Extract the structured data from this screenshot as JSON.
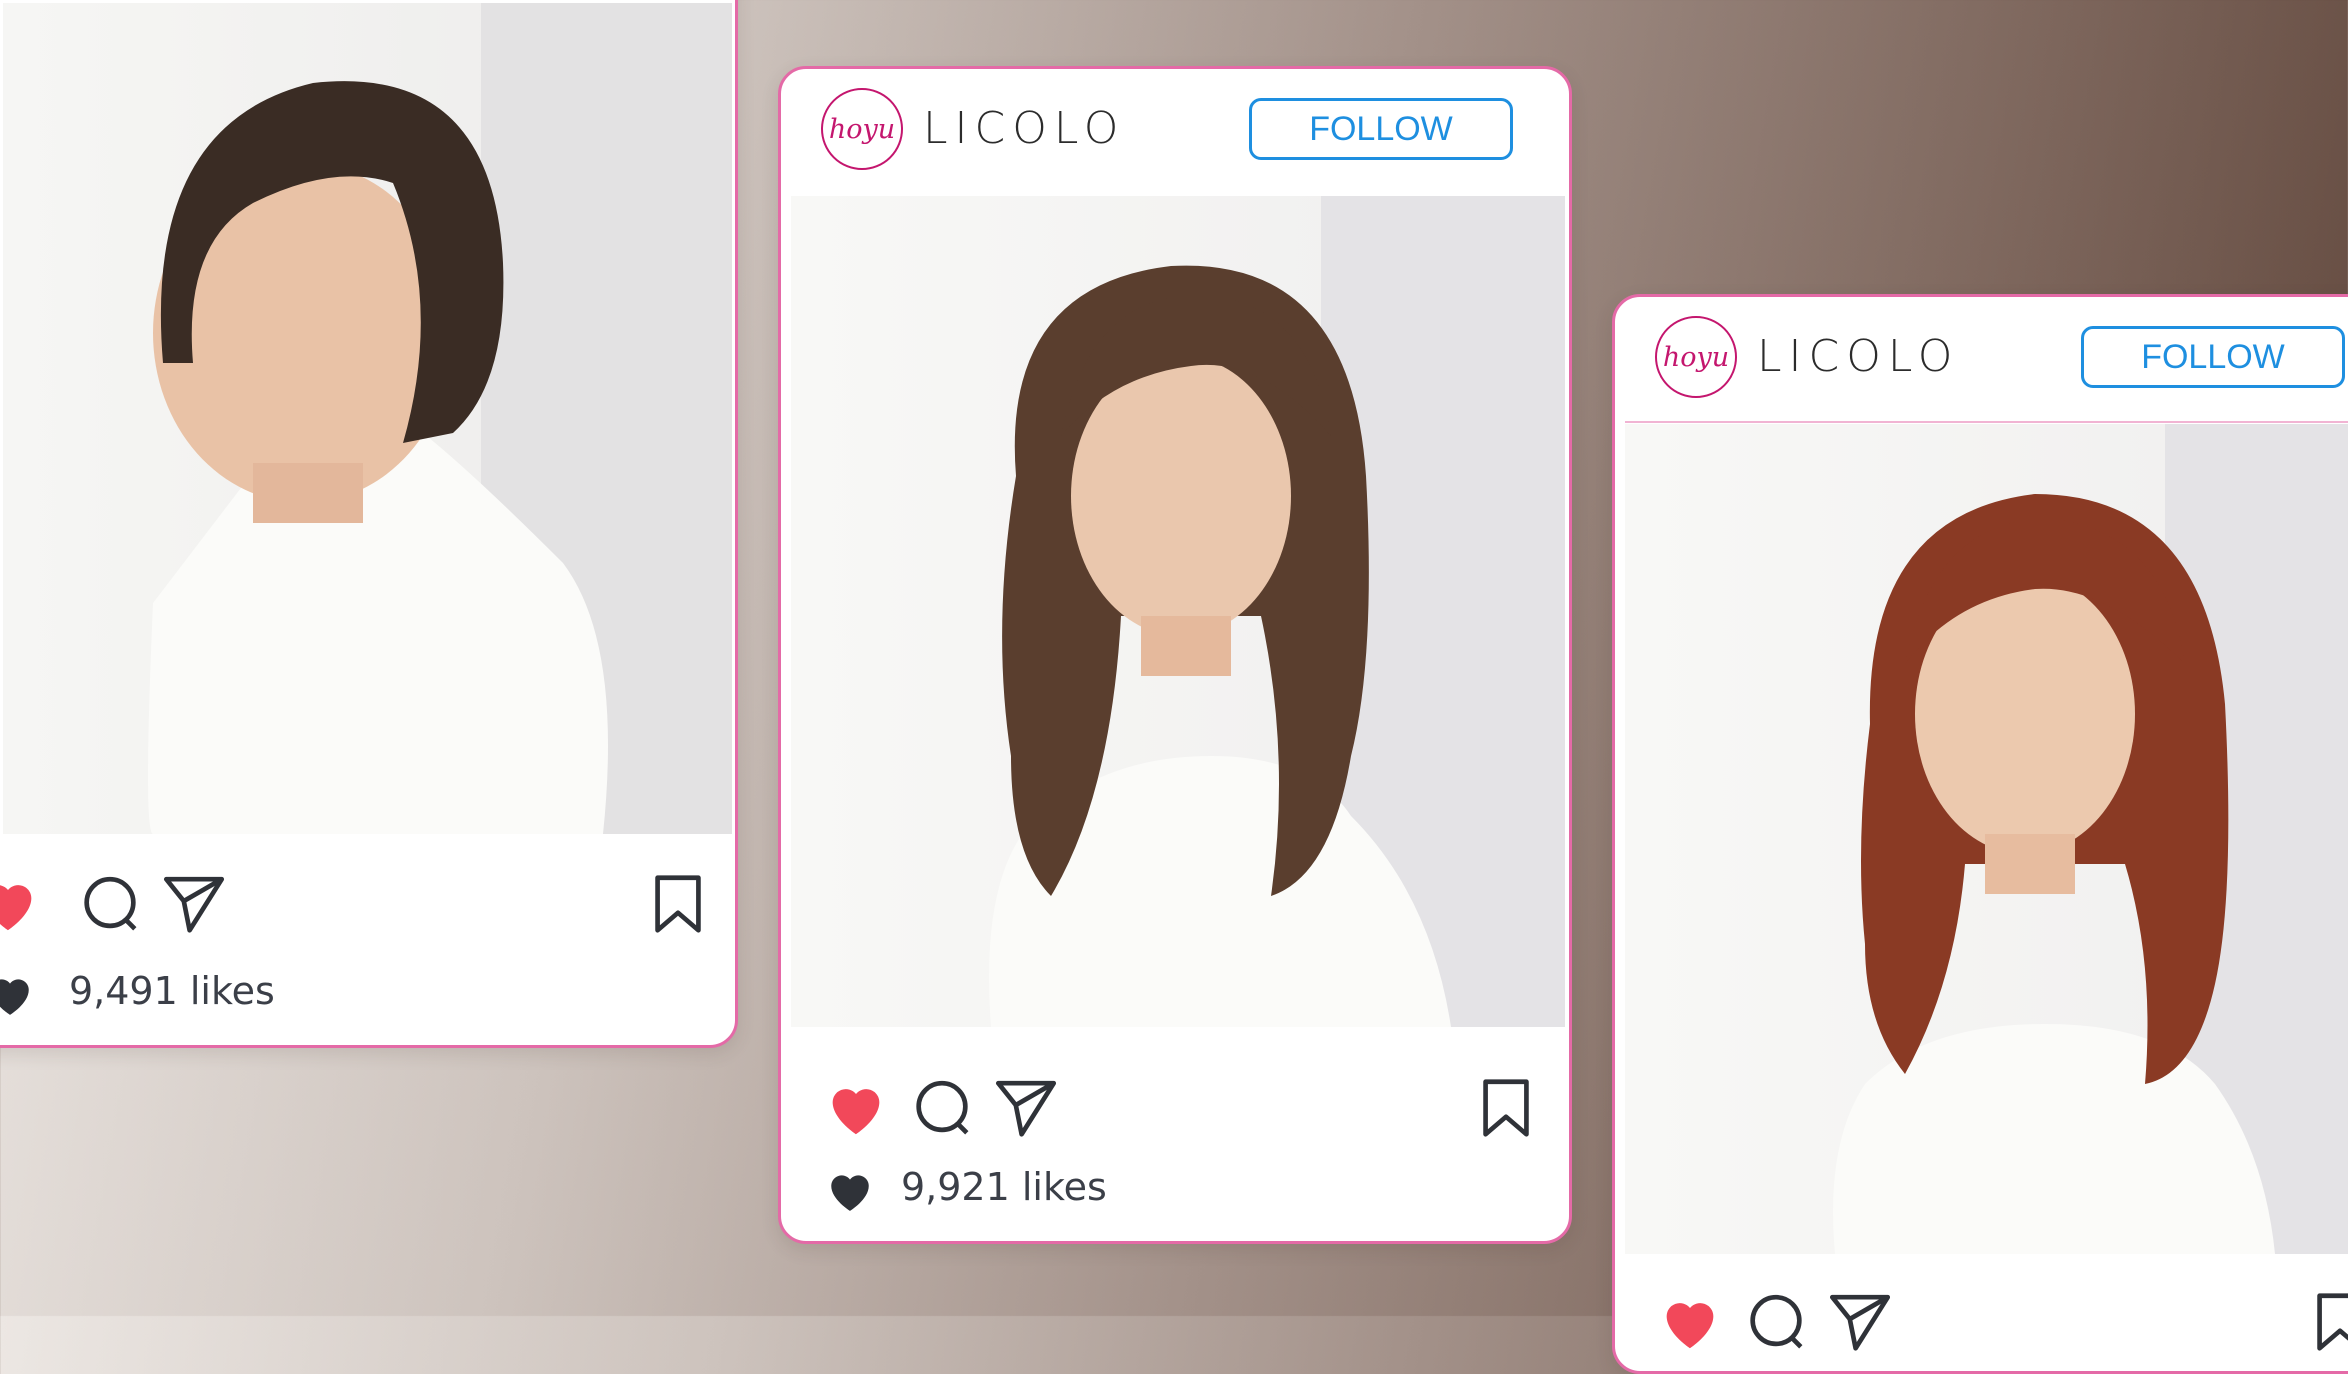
{
  "colors": {
    "card_border": "#e46aa7",
    "logo": "#c4166e",
    "follow": "#1e8fe0",
    "heart_red": "#f2485a",
    "icon_dark": "#2f3238"
  },
  "posts": [
    {
      "id_label": "left",
      "likes_text": "9,491 likes",
      "liked": true,
      "hair_color": "#3a2c24"
    },
    {
      "id_label": "middle",
      "logo_text": "hoyu",
      "brand_name": "LICOLO",
      "follow_label": "FOLLOW",
      "likes_text": "9,921 likes",
      "liked": true,
      "hair_color": "#5a3e2e"
    },
    {
      "id_label": "right",
      "logo_text": "hoyu",
      "brand_name": "LICOLO",
      "follow_label": "FOLLOW",
      "liked": true,
      "hair_color": "#8a3a24"
    }
  ],
  "icons": [
    "heart-icon",
    "comment-icon",
    "share-icon",
    "bookmark-icon",
    "likes-heart-icon"
  ]
}
